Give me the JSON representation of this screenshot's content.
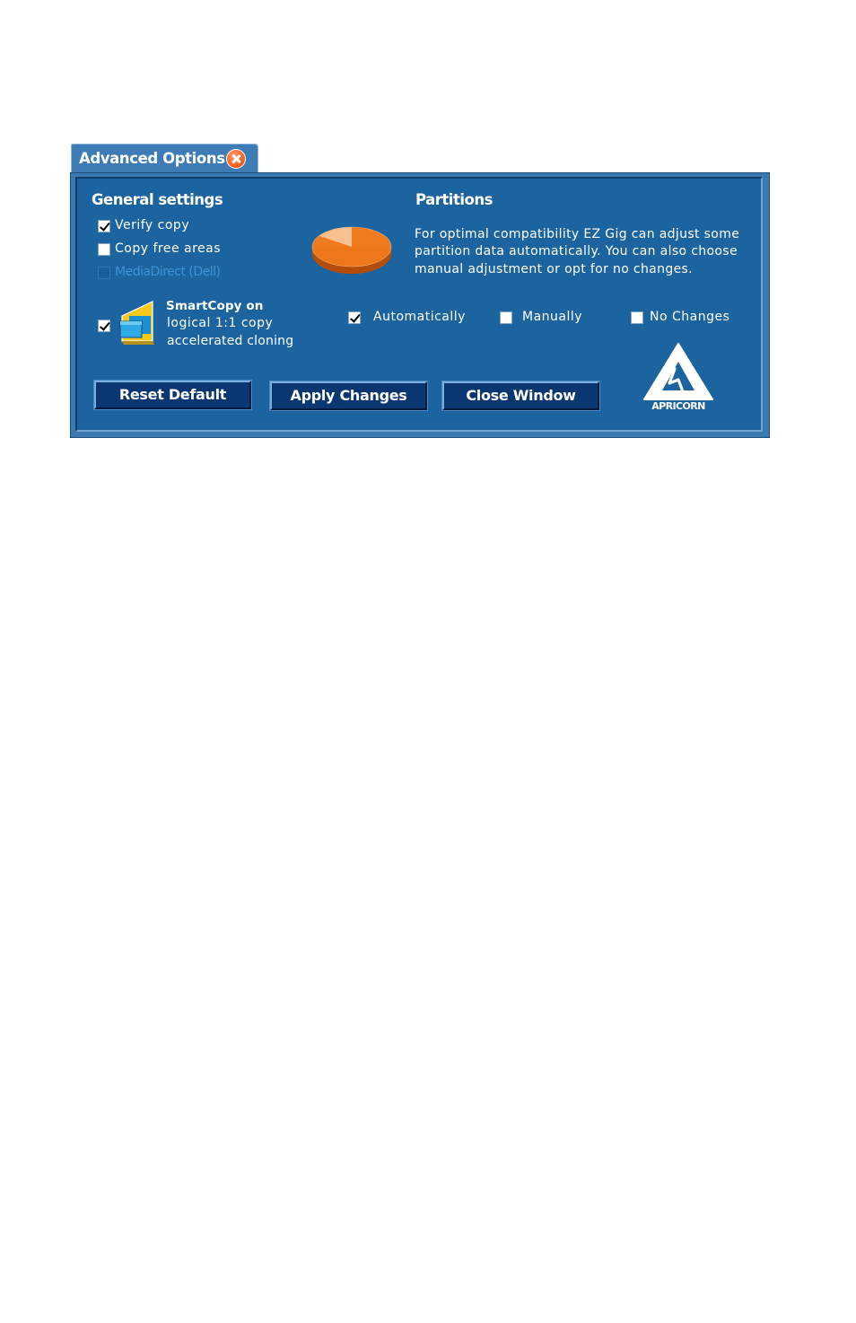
{
  "window": {
    "title": "Advanced Options"
  },
  "general": {
    "heading": "General settings",
    "verify_copy": {
      "label": "Verify copy",
      "checked": true
    },
    "copy_free_areas": {
      "label": "Copy free areas",
      "checked": false
    },
    "media_direct": {
      "label": "MediaDirect (Dell)",
      "checked": false,
      "disabled": true
    },
    "smartcopy": {
      "checked": true,
      "title": "SmartCopy on",
      "line1": "logical 1:1 copy",
      "line2": "accelerated cloning"
    }
  },
  "partitions": {
    "heading": "Partitions",
    "desc_line1": "For optimal compatibility EZ Gig can adjust some",
    "desc_line2": "partition data automatically. You can also choose",
    "desc_line3": "manual adjustment or opt for no changes.",
    "options": [
      {
        "label": "Automatically",
        "checked": true
      },
      {
        "label": "Manually",
        "checked": false
      },
      {
        "label": "No Changes",
        "checked": false
      }
    ]
  },
  "buttons": {
    "reset": "Reset Default",
    "apply": "Apply Changes",
    "close": "Close Window"
  },
  "logo": {
    "text": "APRICORN"
  },
  "colors": {
    "panel": "#1c64a0",
    "frame": "#3c79b1",
    "button": "#0a3672",
    "accent": "#f26522"
  },
  "icons": {
    "close": "close-icon",
    "pie": "pie-chart-icon",
    "smartcopy": "smartcopy-icon",
    "logo": "apricorn-logo"
  }
}
